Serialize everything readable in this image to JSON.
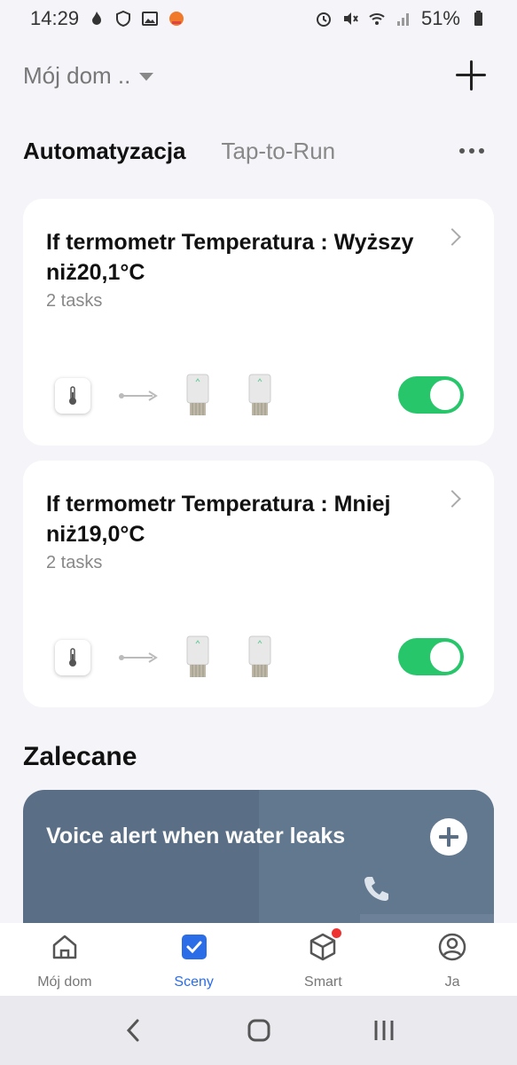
{
  "status_bar": {
    "time": "14:29",
    "battery": "51%"
  },
  "header": {
    "home_name": "Mój dom ..",
    "add_label": "+"
  },
  "tabs": [
    {
      "label": "Automatyzacja",
      "active": true
    },
    {
      "label": "Tap-to-Run",
      "active": false
    }
  ],
  "automations": [
    {
      "title": "If termometr Temperatura : Wyższy niż20,1°C",
      "tasks": "2 tasks",
      "enabled": true
    },
    {
      "title": "If termometr Temperatura : Mniej niż19,0°C",
      "tasks": "2 tasks",
      "enabled": true
    }
  ],
  "recommended": {
    "section_title": "Zalecane",
    "card_title": "Voice alert when water leaks"
  },
  "bottom_nav": [
    {
      "label": "Mój dom",
      "icon": "home-icon"
    },
    {
      "label": "Sceny",
      "icon": "scenes-check-icon",
      "active": true
    },
    {
      "label": "Smart",
      "icon": "smart-cube-icon",
      "badge": true
    },
    {
      "label": "Ja",
      "icon": "profile-icon"
    }
  ],
  "colors": {
    "toggle_on": "#27c66b",
    "accent": "#2a6de6",
    "reco_card": "#5a6f85",
    "badge": "#e33333"
  }
}
